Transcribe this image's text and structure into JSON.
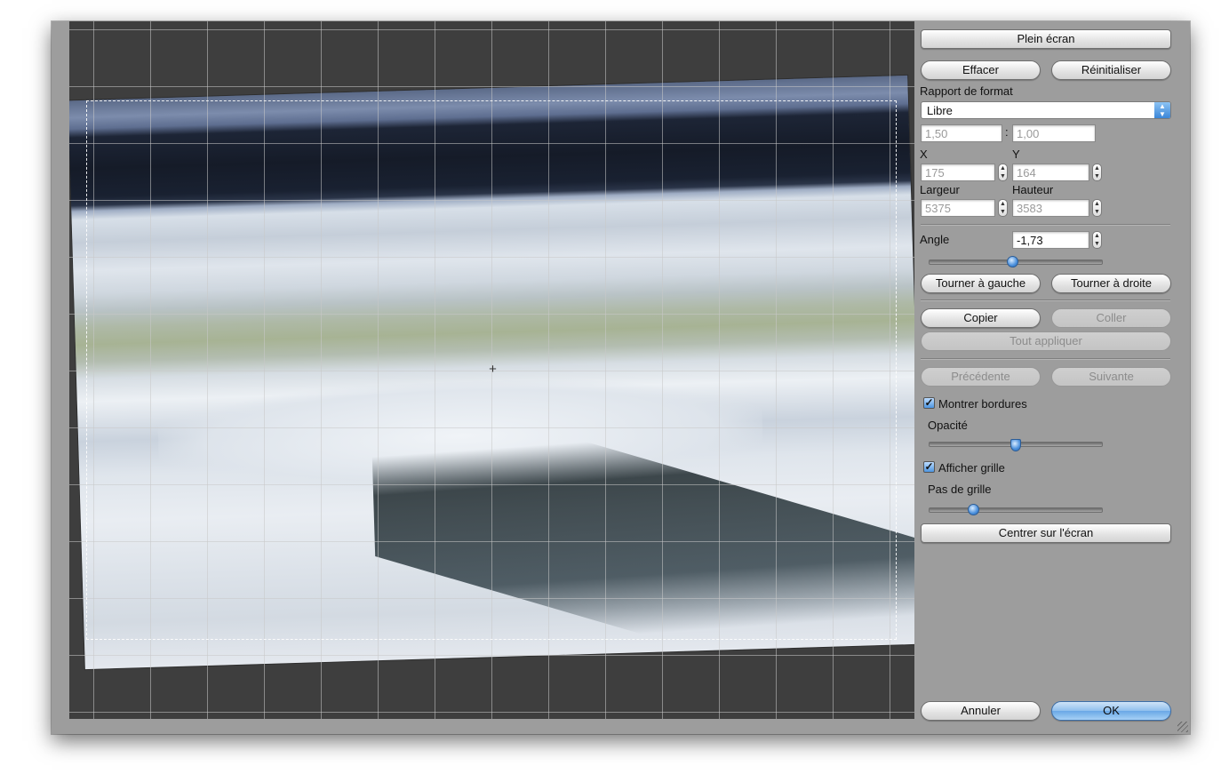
{
  "panel": {
    "fullscreen": "Plein écran",
    "clear": "Effacer",
    "reset": "Réinitialiser",
    "aspect_label": "Rapport de format",
    "aspect_value": "Libre",
    "ratio_a": "1,50",
    "ratio_sep": ":",
    "ratio_b": "1,00",
    "x_label": "X",
    "y_label": "Y",
    "x_value": "175",
    "y_value": "164",
    "width_label": "Largeur",
    "height_label": "Hauteur",
    "width_value": "5375",
    "height_value": "3583",
    "angle_label": "Angle",
    "angle_value": "-1,73",
    "angle_slider_fraction": 0.48,
    "rotate_left": "Tourner à gauche",
    "rotate_right": "Tourner à droite",
    "copy": "Copier",
    "paste": "Coller",
    "apply_all": "Tout appliquer",
    "previous": "Précédente",
    "next": "Suivante",
    "show_borders": "Montrer bordures",
    "show_borders_checked": true,
    "opacity_label": "Opacité",
    "opacity_fraction": 0.5,
    "show_grid": "Afficher grille",
    "show_grid_checked": true,
    "grid_step_label": "Pas de grille",
    "grid_step_fraction": 0.25,
    "center": "Centrer sur l'écran",
    "cancel": "Annuler",
    "ok": "OK"
  },
  "icons": {
    "crosshair": "crosshair-icon",
    "select_arrows": "updown-arrows-icon",
    "stepper": "stepper-arrows-icon",
    "check": "checkmark-icon"
  },
  "colors": {
    "window_bg": "#9d9d9d",
    "canvas_bg": "#3e3e3e",
    "accent_blue": "#6aa8e6"
  }
}
